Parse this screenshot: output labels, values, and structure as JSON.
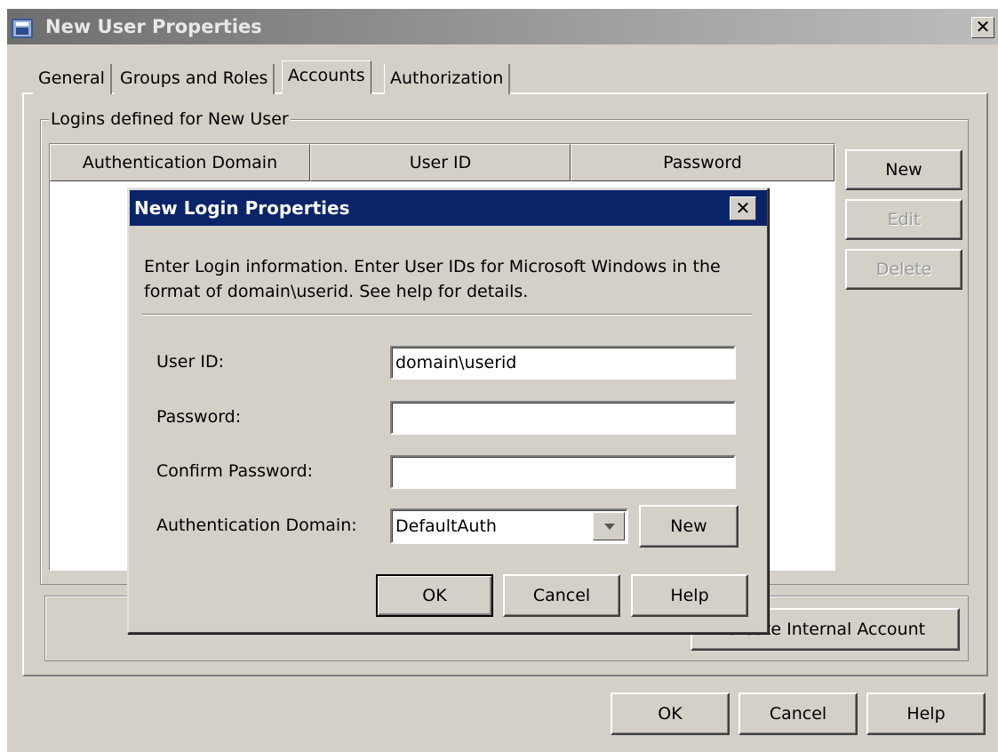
{
  "window": {
    "title": "New User Properties",
    "close_glyph": "✕",
    "icon": "user-properties-icon"
  },
  "tabs": [
    {
      "label": "General"
    },
    {
      "label": "Groups and Roles"
    },
    {
      "label": "Accounts",
      "selected": true
    },
    {
      "label": "Authorization"
    }
  ],
  "logins_group": {
    "label": "Logins defined for New User",
    "columns": [
      "Authentication Domain",
      "User ID",
      "Password"
    ],
    "rows": []
  },
  "side_buttons": {
    "new": "New",
    "edit": "Edit",
    "delete": "Delete"
  },
  "create_internal_label": "Create Internal Account",
  "footer_buttons": {
    "ok": "OK",
    "cancel": "Cancel",
    "help": "Help"
  },
  "dialog": {
    "title": "New Login Properties",
    "close_glyph": "✕",
    "instructions": "Enter Login information. Enter User IDs for Microsoft Windows in the format of domain\\userid. See help for details.",
    "fields": {
      "user_id_label": "User ID:",
      "user_id_value": "domain\\userid",
      "password_label": "Password:",
      "password_value": "",
      "confirm_label": "Confirm Password:",
      "confirm_value": "",
      "domain_label": "Authentication Domain:",
      "domain_value": "DefaultAuth"
    },
    "domain_new_label": "New",
    "buttons": {
      "ok": "OK",
      "cancel": "Cancel",
      "help": "Help"
    }
  },
  "colors": {
    "dialog_titlebar": "#0a246a",
    "window_face": "#d4d0c8"
  }
}
